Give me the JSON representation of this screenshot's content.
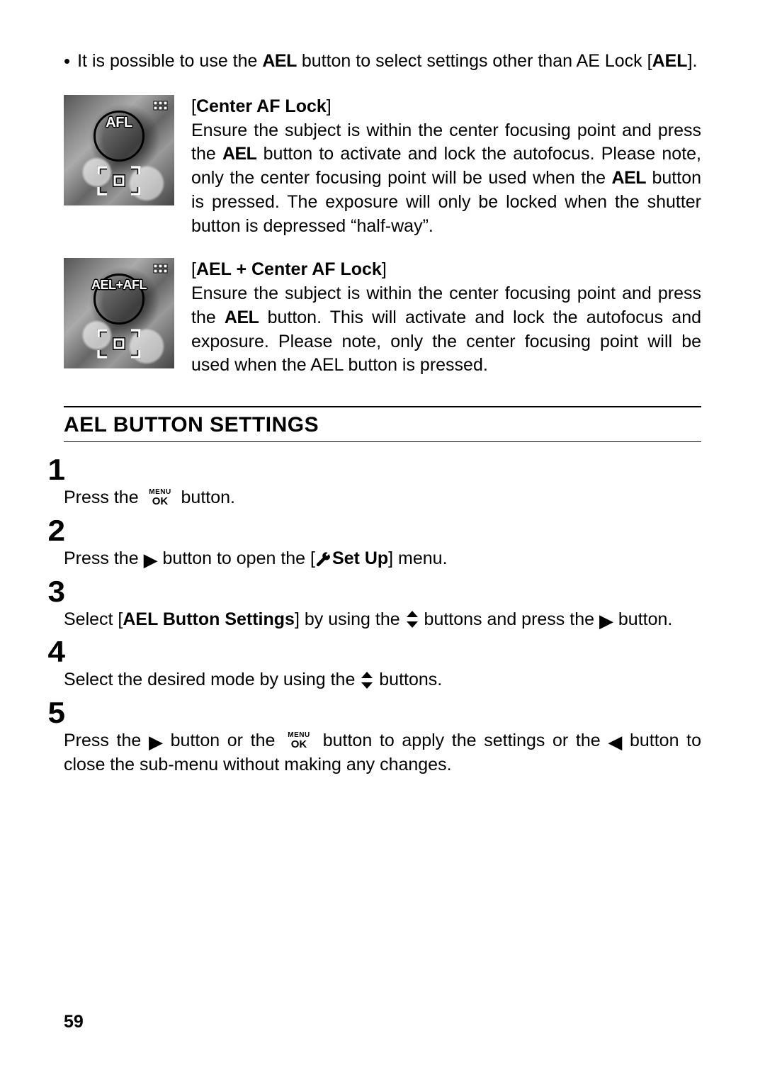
{
  "intro": {
    "text_before_btn": "It is possible to use the ",
    "btn_label": "AEL",
    "text_after_btn": " button to select settings other than AE Lock [",
    "bracket_bold": "AEL",
    "text_end": "]."
  },
  "features": [
    {
      "lcd_label": "AFL",
      "title": "Center AF Lock",
      "body_1": "Ensure the subject is within the center focusing point and press the ",
      "btn": "AEL",
      "body_2": " button to activate and lock the autofocus. Please note, only the center focusing point will be used when the ",
      "btn2": "AEL",
      "body_3": " button is pressed.  The exposure will only be locked when the shutter button is depressed “half-way”."
    },
    {
      "lcd_label": "AEL+AFL",
      "title": "AEL + Center AF Lock",
      "body_1": "Ensure the subject is within the center focusing point and press the ",
      "btn": "AEL",
      "body_2": " button.  This will activate and lock the autofocus and exposure.  Please note, only the center focusing point will be used when the AEL button is pressed.",
      "btn2": "",
      "body_3": ""
    }
  ],
  "section": {
    "heading": "AEL BUTTON SETTINGS"
  },
  "steps": {
    "s1_a": "Press the ",
    "s1_b": " button.",
    "s2_a": "Press the ",
    "s2_b": " button to open the [",
    "s2_setup": "Set Up",
    "s2_c": "] menu.",
    "s3_a": "Select [",
    "s3_bold": "AEL Button Settings",
    "s3_b": "] by using the ",
    "s3_c": " buttons and press the ",
    "s3_d": " button.",
    "s4_a": "Select the desired mode by using the ",
    "s4_b": " buttons.",
    "s5_a": "Press the ",
    "s5_b": " button or the ",
    "s5_c": " button to apply the settings or the ",
    "s5_d": " button to close the sub-menu without making any changes."
  },
  "nums": {
    "n1": "1",
    "n2": "2",
    "n3": "3",
    "n4": "4",
    "n5": "5"
  },
  "page_number": "59"
}
